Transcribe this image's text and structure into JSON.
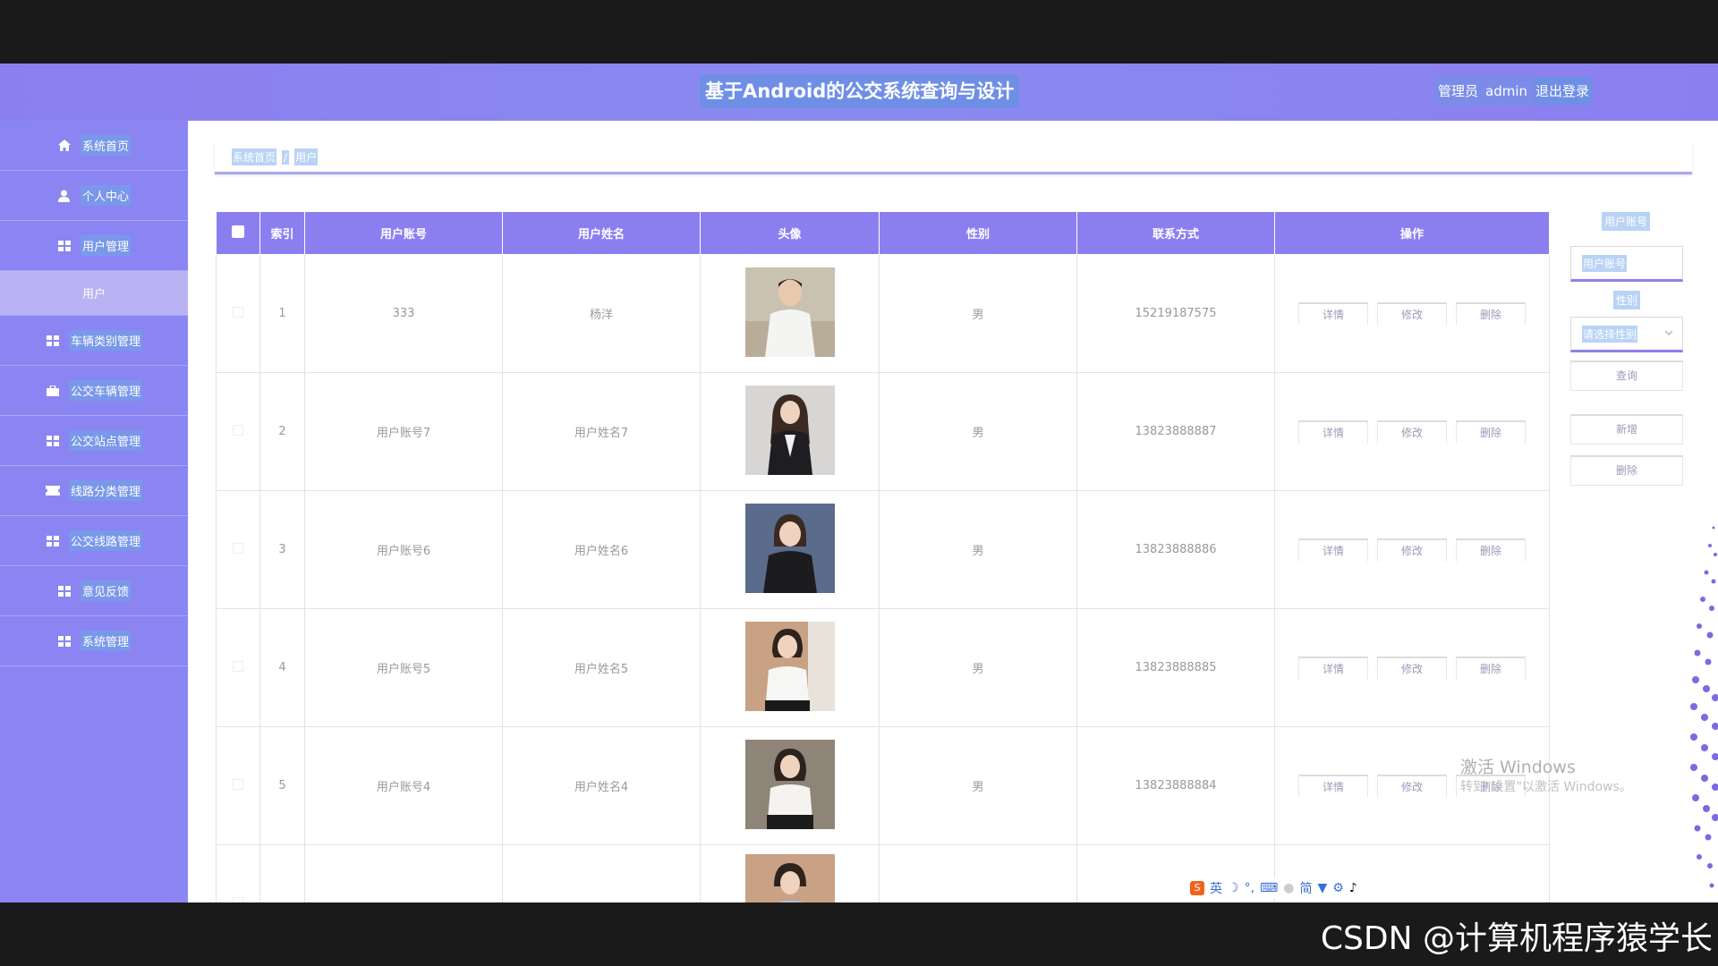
{
  "header": {
    "title": "基于Android的公交系统查询与设计",
    "role": "管理员",
    "username": "admin",
    "logout": "退出登录"
  },
  "sidebar": {
    "items": [
      {
        "label": "系统首页",
        "icon": "home-icon"
      },
      {
        "label": "个人中心",
        "icon": "user-icon"
      },
      {
        "label": "用户管理",
        "icon": "grid-icon"
      },
      {
        "label": "车辆类别管理",
        "icon": "grid-icon"
      },
      {
        "label": "公交车辆管理",
        "icon": "briefcase-icon"
      },
      {
        "label": "公交站点管理",
        "icon": "grid-icon"
      },
      {
        "label": "线路分类管理",
        "icon": "ticket-icon"
      },
      {
        "label": "公交线路管理",
        "icon": "grid-icon"
      },
      {
        "label": "意见反馈",
        "icon": "grid-icon"
      },
      {
        "label": "系统管理",
        "icon": "grid-icon"
      }
    ],
    "sub_item": "用户"
  },
  "breadcrumb": {
    "home": "系统首页",
    "sep": "/",
    "current": "用户"
  },
  "table": {
    "columns": [
      "索引",
      "用户账号",
      "用户姓名",
      "头像",
      "性别",
      "联系方式",
      "操作"
    ],
    "rows": [
      {
        "index": "1",
        "account": "333",
        "name": "杨洋",
        "gender": "男",
        "phone": "15219187575"
      },
      {
        "index": "2",
        "account": "用户账号7",
        "name": "用户姓名7",
        "gender": "男",
        "phone": "13823888887"
      },
      {
        "index": "3",
        "account": "用户账号6",
        "name": "用户姓名6",
        "gender": "男",
        "phone": "13823888886"
      },
      {
        "index": "4",
        "account": "用户账号5",
        "name": "用户姓名5",
        "gender": "男",
        "phone": "13823888885"
      },
      {
        "index": "5",
        "account": "用户账号4",
        "name": "用户姓名4",
        "gender": "男",
        "phone": "13823888884"
      }
    ],
    "actions": {
      "detail": "详情",
      "edit": "修改",
      "delete": "删除"
    }
  },
  "search": {
    "account_label": "用户账号",
    "account_placeholder": "用户账号",
    "gender_label": "性别",
    "gender_placeholder": "请选择性别",
    "query": "查询",
    "add": "新增",
    "delete": "删除"
  },
  "windows": {
    "line1": "激活 Windows",
    "line2": "转到\"设置\"以激活 Windows。"
  },
  "ime": {
    "lang": "英",
    "mode": "简"
  },
  "watermark": "CSDN @计算机程序猿学长",
  "colors": {
    "accent": "#8b7ff0",
    "sidebar": "#8a85f2",
    "highlight": "#b9d3f5"
  }
}
